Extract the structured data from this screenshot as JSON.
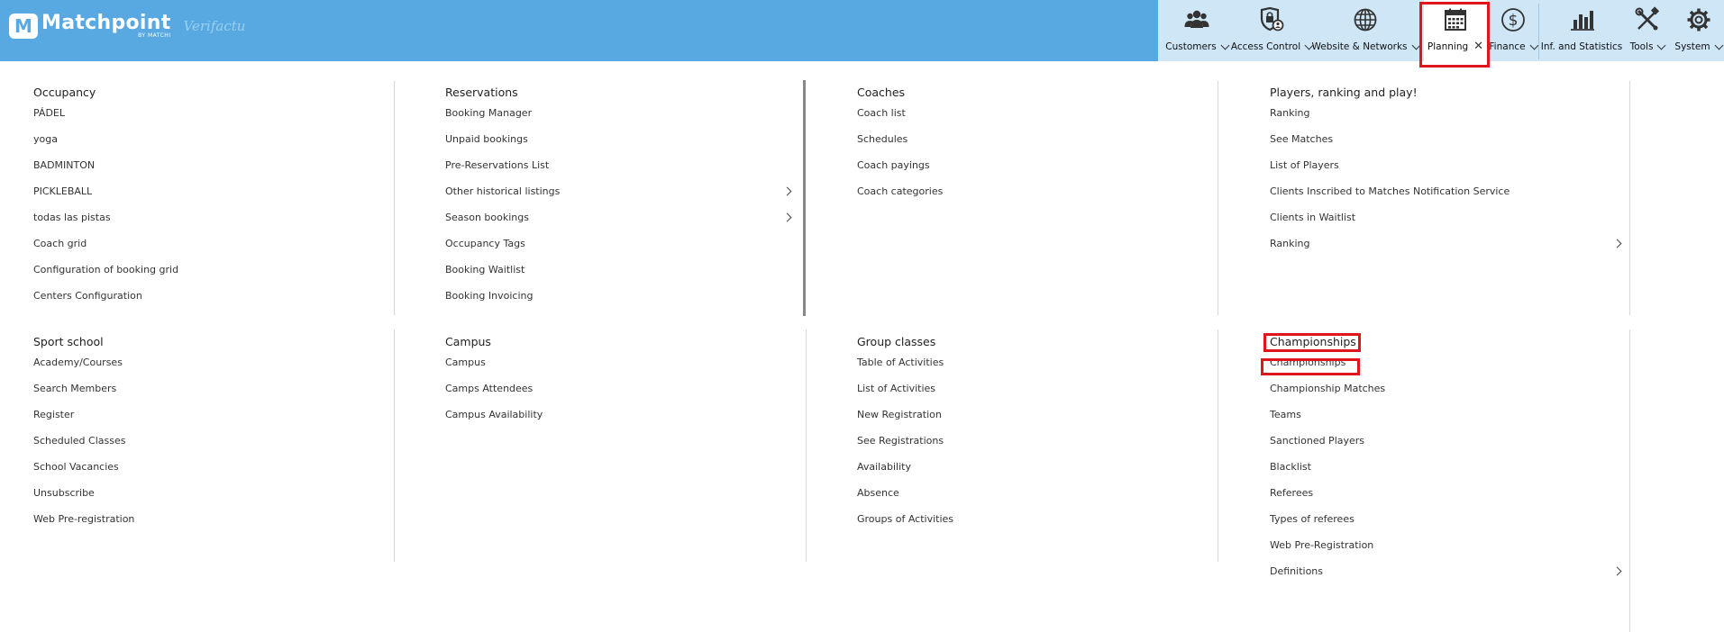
{
  "brand": {
    "name": "Matchpoint",
    "sub": "BY MATCHI",
    "mark": "M",
    "partner": "Verifactu"
  },
  "nav": {
    "items": [
      {
        "label": "Customers",
        "icon": "users-icon"
      },
      {
        "label": "Access Control",
        "icon": "lock-shield-icon"
      },
      {
        "label": "Website & Networks",
        "icon": "globe-icon"
      },
      {
        "label": "Planning",
        "icon": "calendar-icon"
      },
      {
        "label": "Finance",
        "icon": "dollar-circle-icon"
      },
      {
        "label": "Inf. and Statistics",
        "icon": "bar-chart-icon"
      },
      {
        "label": "Tools",
        "icon": "tools-icon"
      },
      {
        "label": "System",
        "icon": "gear-icon"
      }
    ],
    "close_glyph": "✕"
  },
  "menu": {
    "occupancy": {
      "title": "Occupancy",
      "items": [
        "PÁDEL",
        "yoga",
        "BADMINTON",
        "PICKLEBALL",
        "todas las pistas",
        "Coach grid",
        "Configuration of booking grid",
        "Centers Configuration"
      ]
    },
    "reservations": {
      "title": "Reservations",
      "items": [
        "Booking Manager",
        "Unpaid bookings",
        "Pre-Reservations List",
        "Other historical listings",
        "Season bookings",
        "Occupancy Tags",
        "Booking Waitlist",
        "Booking Invoicing"
      ]
    },
    "coaches": {
      "title": "Coaches",
      "items": [
        "Coach list",
        "Schedules",
        "Coach payings",
        "Coach categories"
      ]
    },
    "players": {
      "title": "Players, ranking and play!",
      "items": [
        "Ranking",
        "See Matches",
        "List of Players",
        "Clients Inscribed to Matches Notification Service",
        "Clients in Waitlist",
        "Ranking"
      ]
    },
    "sport_school": {
      "title": "Sport school",
      "items": [
        "Academy/Courses",
        "Search Members",
        "Register",
        "Scheduled Classes",
        "School Vacancies",
        "Unsubscribe",
        "Web Pre-registration"
      ]
    },
    "campus": {
      "title": "Campus",
      "items": [
        "Campus",
        "Camps Attendees",
        "Campus Availability"
      ]
    },
    "group_classes": {
      "title": "Group classes",
      "items": [
        "Table of Activities",
        "List of Activities",
        "New Registration",
        "See Registrations",
        "Availability",
        "Absence",
        "Groups of Activities"
      ]
    },
    "championships": {
      "title": "Championships",
      "items": [
        "Championships",
        "Championship Matches",
        "Teams",
        "Sanctioned Players",
        "Blacklist",
        "Referees",
        "Types of referees",
        "Web Pre-Registration",
        "Definitions"
      ]
    }
  },
  "colors": {
    "header": "#58a8e2",
    "nav_bg": "#cfe6f7",
    "highlight": "#e0161e"
  }
}
